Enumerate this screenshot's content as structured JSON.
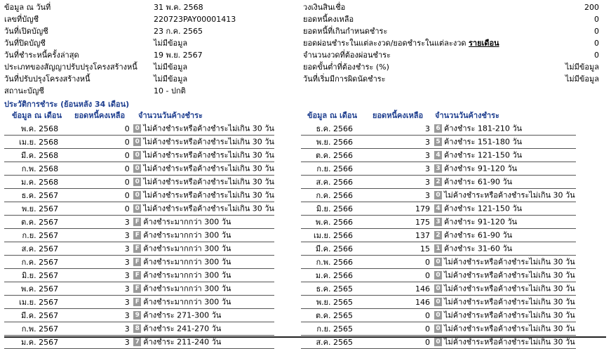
{
  "summary_left": [
    {
      "label": "ข้อมูล ณ วันที่",
      "value": "31 พ.ค. 2568"
    },
    {
      "label": "เลขที่บัญชี",
      "value": "220723PAY00001413"
    },
    {
      "label": "วันที่เปิดบัญชี",
      "value": "23 ก.ค. 2565"
    },
    {
      "label": "วันที่ปิดบัญชี",
      "value": "ไม่มีข้อมูล"
    },
    {
      "label": "วันที่ชำระหนี้ครั้งล่าสุด",
      "value": "19 พ.ย. 2567"
    },
    {
      "label": "ประเภทของสัญญาปรับปรุงโครงสร้างหนี้",
      "value": "ไม่มีข้อมูล"
    },
    {
      "label": "วันที่ปรับปรุงโครงสร้างหนี้",
      "value": "ไม่มีข้อมูล"
    },
    {
      "label": "สถานะบัญชี",
      "value": "10 - ปกติ"
    }
  ],
  "summary_right": [
    {
      "label": "วงเงินสินเชื่อ",
      "value": "200",
      "link": ""
    },
    {
      "label": "ยอดหนี้คงเหลือ",
      "value": "0",
      "link": ""
    },
    {
      "label": "ยอดหนี้ที่เกินกำหนดชำระ",
      "value": "0",
      "link": ""
    },
    {
      "label": "ยอดผ่อนชำระในแต่ละงวด/ยอดชำระในแต่ละงวด",
      "value": "0",
      "link": "รายเดือน"
    },
    {
      "label": "จำนวนงวดที่ต้องผ่อนชำระ",
      "value": "0",
      "link": ""
    },
    {
      "label": "ยอดขั้นต่ำที่ต้องชำระ (%)",
      "value": "ไม่มีข้อมูล",
      "link": ""
    },
    {
      "label": "วันที่เริ่มมีการผิดนัดชำระ",
      "value": "ไม่มีข้อมูล",
      "link": ""
    }
  ],
  "history": {
    "title": "ประวัติการชำระ (ย้อนหลัง 34 เดือน)",
    "headers": {
      "month": "ข้อมูล ณ เดือน",
      "balance": "ยอดหนี้คงเหลือ",
      "days": "จำนวนวันค้างชำระ"
    },
    "left": [
      {
        "month": "พ.ค. 2568",
        "balance": "0",
        "code": "0",
        "status": "ไม่ค้างชำระหรือค้างชำระไม่เกิน 30 วัน"
      },
      {
        "month": "เม.ย. 2568",
        "balance": "0",
        "code": "0",
        "status": "ไม่ค้างชำระหรือค้างชำระไม่เกิน 30 วัน"
      },
      {
        "month": "มี.ค. 2568",
        "balance": "0",
        "code": "0",
        "status": "ไม่ค้างชำระหรือค้างชำระไม่เกิน 30 วัน"
      },
      {
        "month": "ก.พ. 2568",
        "balance": "0",
        "code": "0",
        "status": "ไม่ค้างชำระหรือค้างชำระไม่เกิน 30 วัน"
      },
      {
        "month": "ม.ค. 2568",
        "balance": "0",
        "code": "0",
        "status": "ไม่ค้างชำระหรือค้างชำระไม่เกิน 30 วัน"
      },
      {
        "month": "ธ.ค. 2567",
        "balance": "0",
        "code": "0",
        "status": "ไม่ค้างชำระหรือค้างชำระไม่เกิน 30 วัน"
      },
      {
        "month": "พ.ย. 2567",
        "balance": "0",
        "code": "0",
        "status": "ไม่ค้างชำระหรือค้างชำระไม่เกิน 30 วัน"
      },
      {
        "month": "ต.ค. 2567",
        "balance": "3",
        "code": "F",
        "status": "ค้างชำระมากกว่า 300 วัน"
      },
      {
        "month": "ก.ย. 2567",
        "balance": "3",
        "code": "F",
        "status": "ค้างชำระมากกว่า 300 วัน"
      },
      {
        "month": "ส.ค. 2567",
        "balance": "3",
        "code": "F",
        "status": "ค้างชำระมากกว่า 300 วัน"
      },
      {
        "month": "ก.ค. 2567",
        "balance": "3",
        "code": "F",
        "status": "ค้างชำระมากกว่า 300 วัน"
      },
      {
        "month": "มิ.ย. 2567",
        "balance": "3",
        "code": "F",
        "status": "ค้างชำระมากกว่า 300 วัน"
      },
      {
        "month": "พ.ค. 2567",
        "balance": "3",
        "code": "F",
        "status": "ค้างชำระมากกว่า 300 วัน"
      },
      {
        "month": "เม.ย. 2567",
        "balance": "3",
        "code": "F",
        "status": "ค้างชำระมากกว่า 300 วัน"
      },
      {
        "month": "มี.ค. 2567",
        "balance": "3",
        "code": "9",
        "status": "ค้างชำระ 271-300 วัน"
      },
      {
        "month": "ก.พ. 2567",
        "balance": "3",
        "code": "8",
        "status": "ค้างชำระ 241-270 วัน"
      },
      {
        "month": "ม.ค. 2567",
        "balance": "3",
        "code": "7",
        "status": "ค้างชำระ 211-240 วัน"
      }
    ],
    "right": [
      {
        "month": "ธ.ค. 2566",
        "balance": "3",
        "code": "6",
        "status": "ค้างชำระ 181-210 วัน"
      },
      {
        "month": "พ.ย. 2566",
        "balance": "3",
        "code": "5",
        "status": "ค้างชำระ 151-180 วัน"
      },
      {
        "month": "ต.ค. 2566",
        "balance": "3",
        "code": "4",
        "status": "ค้างชำระ 121-150 วัน"
      },
      {
        "month": "ก.ย. 2566",
        "balance": "3",
        "code": "3",
        "status": "ค้างชำระ 91-120 วัน"
      },
      {
        "month": "ส.ค. 2566",
        "balance": "3",
        "code": "2",
        "status": "ค้างชำระ 61-90 วัน"
      },
      {
        "month": "ก.ค. 2566",
        "balance": "3",
        "code": "0",
        "status": "ไม่ค้างชำระหรือค้างชำระไม่เกิน 30 วัน"
      },
      {
        "month": "มิ.ย. 2566",
        "balance": "179",
        "code": "4",
        "status": "ค้างชำระ 121-150 วัน"
      },
      {
        "month": "พ.ค. 2566",
        "balance": "175",
        "code": "3",
        "status": "ค้างชำระ 91-120 วัน"
      },
      {
        "month": "เม.ย. 2566",
        "balance": "137",
        "code": "2",
        "status": "ค้างชำระ 61-90 วัน"
      },
      {
        "month": "มี.ค. 2566",
        "balance": "15",
        "code": "1",
        "status": "ค้างชำระ 31-60 วัน"
      },
      {
        "month": "ก.พ. 2566",
        "balance": "0",
        "code": "0",
        "status": "ไม่ค้างชำระหรือค้างชำระไม่เกิน 30 วัน"
      },
      {
        "month": "ม.ค. 2566",
        "balance": "0",
        "code": "0",
        "status": "ไม่ค้างชำระหรือค้างชำระไม่เกิน 30 วัน"
      },
      {
        "month": "ธ.ค. 2565",
        "balance": "146",
        "code": "0",
        "status": "ไม่ค้างชำระหรือค้างชำระไม่เกิน 30 วัน"
      },
      {
        "month": "พ.ย. 2565",
        "balance": "146",
        "code": "0",
        "status": "ไม่ค้างชำระหรือค้างชำระไม่เกิน 30 วัน"
      },
      {
        "month": "ต.ค. 2565",
        "balance": "0",
        "code": "0",
        "status": "ไม่ค้างชำระหรือค้างชำระไม่เกิน 30 วัน"
      },
      {
        "month": "ก.ย. 2565",
        "balance": "0",
        "code": "0",
        "status": "ไม่ค้างชำระหรือค้างชำระไม่เกิน 30 วัน"
      },
      {
        "month": "ส.ค. 2565",
        "balance": "0",
        "code": "0",
        "status": "ไม่ค้างชำระหรือค้างชำระไม่เกิน 30 วัน"
      }
    ]
  }
}
